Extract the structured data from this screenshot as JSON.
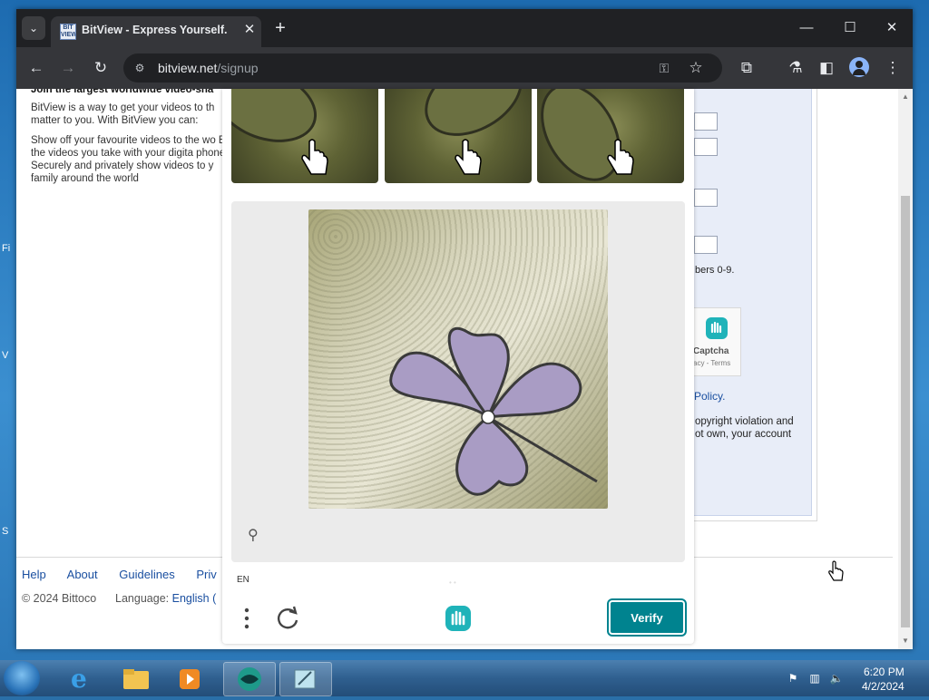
{
  "tab": {
    "title": "BitView - Express Yourself.",
    "favicon_text": "BIT VIEW"
  },
  "address_bar": {
    "domain": "bitview.net",
    "path": "/signup"
  },
  "page": {
    "intro_heading": "Join the largest worldwide video-sha",
    "intro_p1": "BitView is a way to get your videos to th matter to you. With BitView you can:",
    "intro_p2": "Show off your favourite videos to the wo Blog the videos you take with your digita phone Securely and privately show videos to y family around the world",
    "numbers_hint": "bers 0-9.",
    "policy_link": "Policy.",
    "violation_text": "opyright violation and ot own, your account",
    "footer_links": [
      "Help",
      "About",
      "Guidelines",
      "Priv"
    ],
    "copyright": "© 2024 Bittoco",
    "language_label": "Language:",
    "language_value": "English ("
  },
  "hcaptcha_widget": {
    "label": "Captcha",
    "terms": "acy - Terms"
  },
  "captcha": {
    "language": "EN",
    "verify_label": "Verify",
    "dots": "• •"
  },
  "taskbar": {
    "time": "6:20 PM",
    "date": "4/2/2024"
  },
  "desktop_letters": [
    "Fi",
    "V",
    "S"
  ]
}
